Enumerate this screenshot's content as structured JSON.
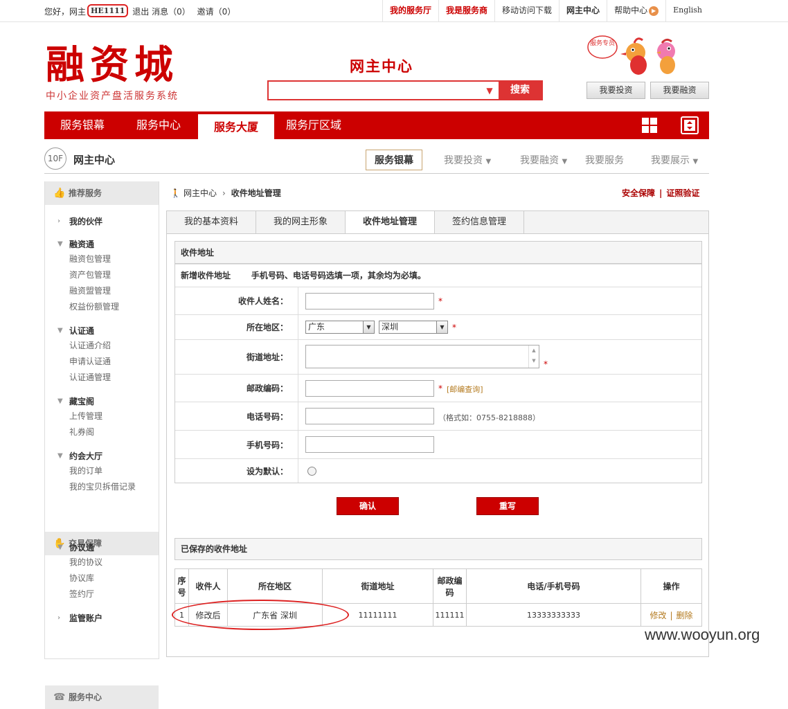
{
  "topbar": {
    "greeting": "您好，网主",
    "username": "HE1111",
    "logout": "退出",
    "messages": "消息（0）",
    "invites": "邀请（0）",
    "links": [
      "我的服务厅",
      "我是服务商",
      "移动访问下载",
      "网主中心",
      "帮助中心",
      "English"
    ]
  },
  "header": {
    "logo_main": "融资城",
    "logo_sub": "中小企业资产盘活服务系统",
    "center_title": "网主中心",
    "search_placeholder": "",
    "search_button": "搜索",
    "mascot_badge": "服务专员",
    "invest_button": "我要投资",
    "finance_button": "我要融资"
  },
  "nav": {
    "items": [
      "服务银幕",
      "服务中心",
      "服务大厦",
      "服务厅区域"
    ],
    "active_index": 2
  },
  "floor": {
    "badge": "10F",
    "title": "网主中心",
    "menu": [
      "服务银幕",
      "我要投资",
      "我要融资",
      "我要服务",
      "我要展示"
    ]
  },
  "sidebar": {
    "section1": "推荐服务",
    "partner": "我的伙伴",
    "rongzitong": "融资通",
    "rongzitong_items": [
      "融资包管理",
      "资产包管理",
      "融资盟管理",
      "权益份额管理"
    ],
    "renzhengtong": "认证通",
    "renzhengtong_items": [
      "认证通介绍",
      "申请认证通",
      "认证通管理"
    ],
    "cangbaoge": "藏宝阁",
    "cangbaoge_items": [
      "上传管理",
      "礼券阁"
    ],
    "yuehui": "约会大厅",
    "yuehui_items": [
      "我的订单",
      "我的宝贝拆借记录"
    ],
    "section2": "交易保障",
    "xieyitong": "协议通",
    "xieyitong_items": [
      "我的协议",
      "协议库",
      "签约厅"
    ],
    "jianguan": "监管账户",
    "section3": "服务中心"
  },
  "breadcrumb": {
    "home": "网主中心",
    "current": "收件地址管理",
    "security": "安全保障",
    "sep": "|",
    "cert": "证照验证"
  },
  "tabs": [
    "我的基本资料",
    "我的网主形象",
    "收件地址管理",
    "签约信息管理"
  ],
  "form": {
    "section_title": "收件地址",
    "new_title": "新增收件地址",
    "note": "手机号码、电话号码选填一项，其余均为必填。",
    "name_label": "收件人姓名：",
    "region_label": "所在地区：",
    "province": "广东",
    "city": "深圳",
    "street_label": "街道地址：",
    "zip_label": "邮政编码：",
    "zip_link": "[邮编查询]",
    "phone_label": "电话号码：",
    "phone_hint": "（格式如：0755-8218888）",
    "mobile_label": "手机号码：",
    "default_label": "设为默认：",
    "required_mark": "*",
    "confirm": "确认",
    "reset": "重写"
  },
  "saved": {
    "title": "已保存的收件地址",
    "headers": [
      "序号",
      "收件人",
      "所在地区",
      "街道地址",
      "邮政编码",
      "电话/手机号码",
      "操作"
    ],
    "row": {
      "index": "1",
      "name": "修改后",
      "region": "广东省 深圳",
      "street": "11111111",
      "zip": "111111",
      "phone": "13333333333",
      "edit": "修改",
      "sep": "|",
      "delete": "删除"
    }
  },
  "watermark": "www.wooyun.org",
  "colors": {
    "brand_red": "#cc0000",
    "link_brown": "#b47a1f"
  }
}
